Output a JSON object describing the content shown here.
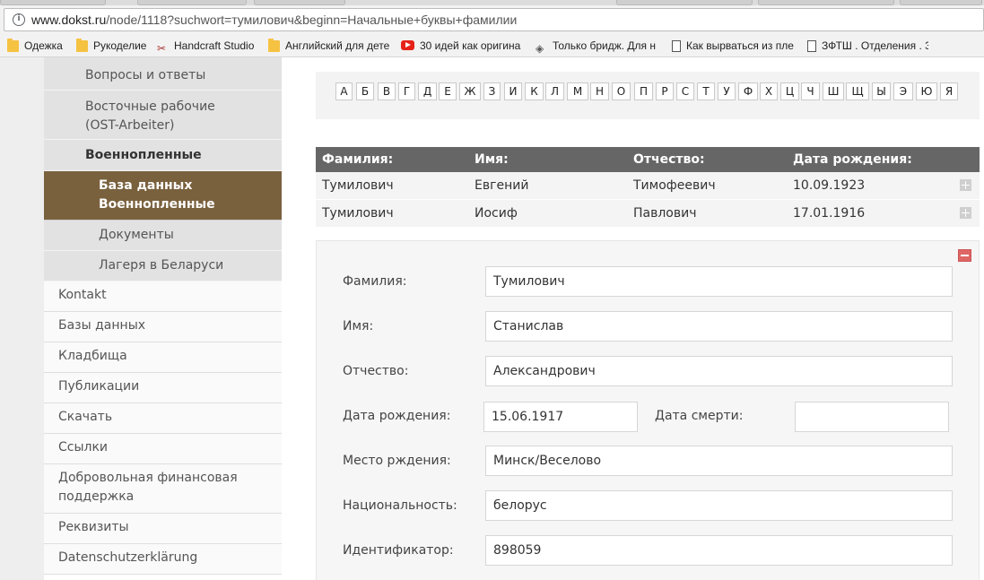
{
  "browser": {
    "url_host": "www.dokst.ru",
    "url_path": "/node/1118?suchwort=тумилович&beginn=Начальные+буквы+фамилии",
    "bookmarks": [
      {
        "label": "Одежка",
        "icon": "folder-icon"
      },
      {
        "label": "Рукоделие",
        "icon": "folder-icon"
      },
      {
        "label": "Handcraft Studio",
        "icon": "scissors-icon"
      },
      {
        "label": "Английский для дете",
        "icon": "folder-icon"
      },
      {
        "label": "30 идей как оригина",
        "icon": "youtube-icon"
      },
      {
        "label": "Только бридж. Для н",
        "icon": "cards-icon"
      },
      {
        "label": "Как вырваться из пле",
        "icon": "page-icon"
      },
      {
        "label": "ЗФТШ . Отделения . З",
        "icon": "page-icon"
      }
    ]
  },
  "sidebar": {
    "items": [
      {
        "label": "Вопросы и ответы"
      },
      {
        "label": "Восточные рабочие (OST-Arbeiter)"
      },
      {
        "label": "Военнопленные"
      },
      {
        "label": "База данных Военнопленные"
      },
      {
        "label": "Документы"
      },
      {
        "label": "Лагеря в Беларуси"
      },
      {
        "label": "Kontakt"
      },
      {
        "label": "Базы данных"
      },
      {
        "label": "Кладбища"
      },
      {
        "label": "Публикации"
      },
      {
        "label": "Скачать"
      },
      {
        "label": "Ссылки"
      },
      {
        "label": "Добровольная финансовая поддержка"
      },
      {
        "label": "Реквизиты"
      },
      {
        "label": "Datenschutzerklärung"
      }
    ]
  },
  "letters": [
    "А",
    "Б",
    "В",
    "Г",
    "Д",
    "Е",
    "Ж",
    "З",
    "И",
    "К",
    "Л",
    "М",
    "Н",
    "О",
    "П",
    "Р",
    "С",
    "Т",
    "У",
    "Ф",
    "Х",
    "Ц",
    "Ч",
    "Ш",
    "Щ",
    "Ы",
    "Э",
    "Ю",
    "Я"
  ],
  "results": {
    "headers": [
      "Фамилия:",
      "Имя:",
      "Отчество:",
      "Дата рождения:"
    ],
    "rows": [
      [
        "Тумилович",
        "Евгений",
        "Тимофеевич",
        "10.09.1923"
      ],
      [
        "Тумилович",
        "Иосиф",
        "Павлович",
        "17.01.1916"
      ]
    ]
  },
  "detail": {
    "surname_label": "Фамилия:",
    "surname": "Тумилович",
    "name_label": "Имя:",
    "name": "Станислав",
    "patronymic_label": "Отчество:",
    "patronymic": "Александрович",
    "birth_label": "Дата рождения:",
    "birth": "15.06.1917",
    "death_label": "Дата смерти:",
    "death": "",
    "birthplace_label": "Место рждения:",
    "birthplace": "Минск/Веселово",
    "nationality_label": "Национальность:",
    "nationality": "белорус",
    "id_label": "Идентификатор:",
    "id": "898059"
  }
}
